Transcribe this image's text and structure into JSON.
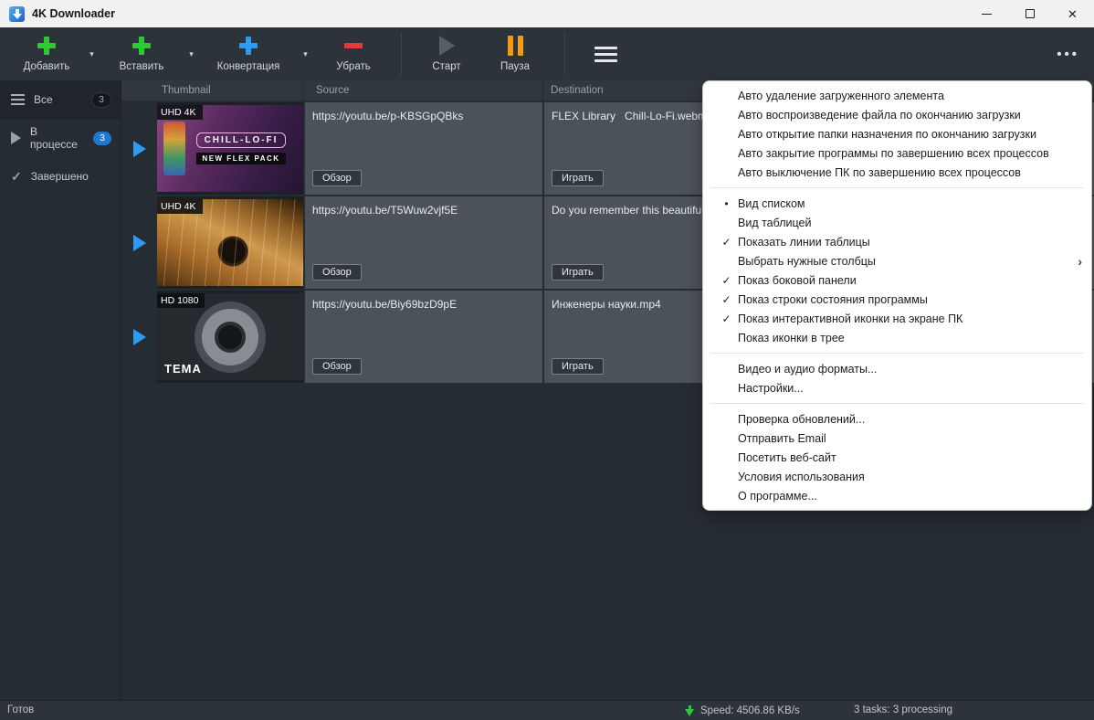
{
  "window": {
    "title": "4K Downloader"
  },
  "icons": {
    "dropdown": "▾",
    "close": "✕",
    "ellipsis": "•••",
    "check": "✓",
    "submenu": "›"
  },
  "toolbar": {
    "add": "Добавить",
    "paste": "Вставить",
    "convert": "Конвертация",
    "remove": "Убрать",
    "start": "Старт",
    "pause": "Пауза"
  },
  "sidebar": {
    "all": "Все",
    "all_badge": "3",
    "in_progress": "В процессе",
    "in_progress_badge": "3",
    "completed": "Завершено"
  },
  "table": {
    "headers": {
      "thumbnail": "Thumbnail",
      "source": "Source",
      "destination": "Destination"
    },
    "rows": [
      {
        "quality": "UHD 4K",
        "thumb_title": "CHILL-LO-FI",
        "thumb_subtitle": "NEW FLEX PACK",
        "source": "https://youtu.be/p-KBSGpQBks",
        "browse": "Обзор",
        "destination": "FLEX Library   Chill-Lo-Fi.webm",
        "play": "Играть"
      },
      {
        "quality": "UHD 4K",
        "source": "https://youtu.be/T5Wuw2vjf5E",
        "browse": "Обзор",
        "destination": "Do you remember this beautiful song",
        "play": "Играть"
      },
      {
        "quality": "HD 1080",
        "thumb_title": "ТЕМА",
        "source": "https://youtu.be/Biy69bzD9pE",
        "browse": "Обзор",
        "destination": "Инженеры науки.mp4",
        "play": "Играть"
      }
    ]
  },
  "menu": {
    "items": [
      {
        "label": "Авто удаление загруженного элемента"
      },
      {
        "label": "Авто воспроизведение файла по окончанию загрузки"
      },
      {
        "label": "Авто открытие папки назначения по окончанию загрузки"
      },
      {
        "label": "Авто закрытие программы по завершению всех процессов"
      },
      {
        "label": "Авто выключение ПК по завершению всех процессов"
      },
      {
        "label": "Вид списком",
        "mark": "•"
      },
      {
        "label": "Вид таблицей"
      },
      {
        "label": "Показать линии таблицы",
        "mark": "✓"
      },
      {
        "label": "Выбрать нужные столбцы",
        "arrow": "›"
      },
      {
        "label": "Показ боковой панели",
        "mark": "✓"
      },
      {
        "label": "Показ строки состояния программы",
        "mark": "✓"
      },
      {
        "label": "Показ интерактивной иконки на экране ПК",
        "mark": "✓"
      },
      {
        "label": "Показ иконки в трее"
      },
      {
        "label": "Видео и аудио форматы..."
      },
      {
        "label": "Настройки..."
      },
      {
        "label": "Проверка обновлений..."
      },
      {
        "label": "Отправить Email"
      },
      {
        "label": "Посетить веб-сайт"
      },
      {
        "label": "Условия использования"
      },
      {
        "label": "О программе..."
      }
    ]
  },
  "statusbar": {
    "ready": "Готов",
    "speed": "Speed: 4506.86 KB/s",
    "tasks": "3 tasks: 3 processing"
  },
  "colors": {
    "accent_blue": "#2d9bf0",
    "plus_green": "#31c931",
    "convert_blue": "#2e9bf0",
    "remove_red": "#e23b3b",
    "pause_orange": "#f39b12",
    "badge_blue": "#1f78d1",
    "speed_green": "#27c93f"
  }
}
